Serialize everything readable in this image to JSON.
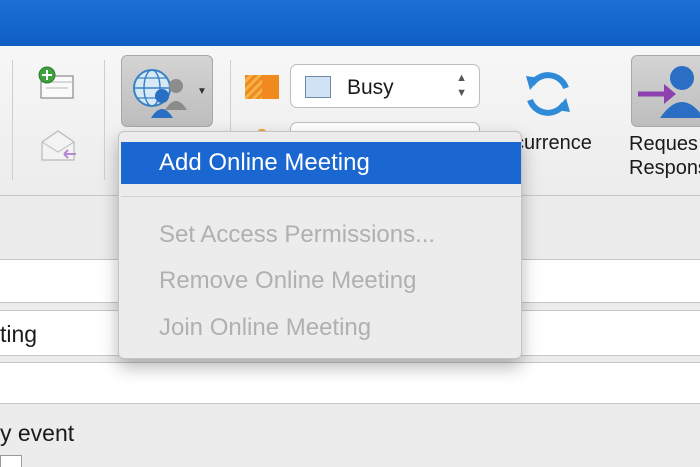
{
  "toolbar": {
    "show_as": {
      "selected": "Busy",
      "swatch_color": "#cfe3f5"
    },
    "recurrence_label": "currence",
    "request_responses_label_line1": "Reques",
    "request_responses_label_line2": "Respons"
  },
  "online_meeting_menu": {
    "items": [
      {
        "label": "Add Online Meeting",
        "enabled": true,
        "highlighted": true
      },
      {
        "label": "Set Access Permissions...",
        "enabled": false
      },
      {
        "label": "Remove Online Meeting",
        "enabled": false
      },
      {
        "label": "Join Online Meeting",
        "enabled": false
      }
    ]
  },
  "form": {
    "location_partial": "ting",
    "all_day_partial": "y event"
  },
  "colors": {
    "titlebar": "#1267cf",
    "menu_highlight": "#1a67d2",
    "recurrence_icon": "#2f8ad8",
    "request_icon_purple": "#8e3fb0",
    "slot_icon_orange": "#f08a1f"
  },
  "icons": {
    "new_item": "envelope-plus-icon",
    "forward": "envelope-forward-icon",
    "online_meeting": "globe-people-icon",
    "time_slot": "striped-block-icon",
    "recurrence": "refresh-cycle-icon",
    "request_responses": "person-arrow-icon"
  }
}
